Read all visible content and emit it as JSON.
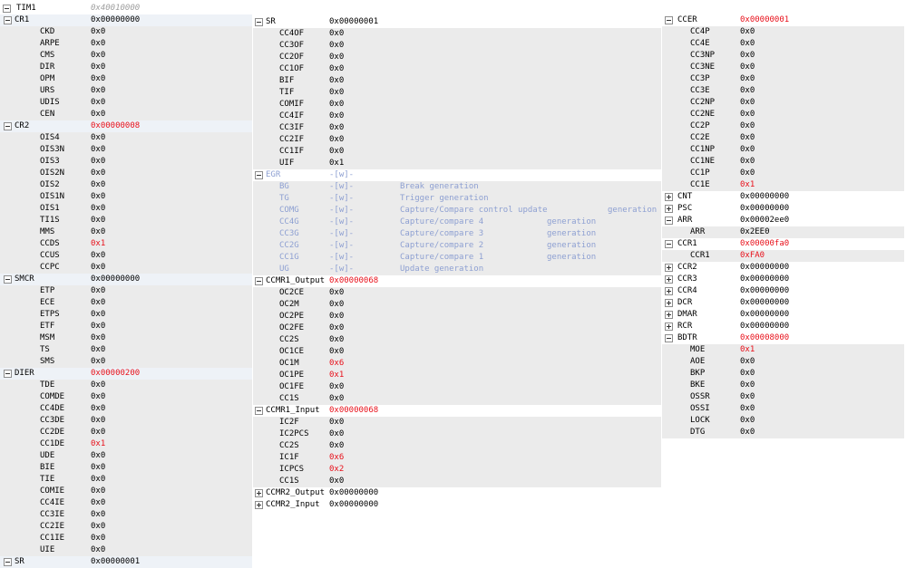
{
  "header": {
    "name": "TIM1",
    "address": "0x40010000"
  },
  "columns": [
    [
      {
        "name": "CR1",
        "value": "0x00000000",
        "expanded": true,
        "fields": [
          [
            "CKD",
            "0x0"
          ],
          [
            "ARPE",
            "0x0"
          ],
          [
            "CMS",
            "0x0"
          ],
          [
            "DIR",
            "0x0"
          ],
          [
            "OPM",
            "0x0"
          ],
          [
            "URS",
            "0x0"
          ],
          [
            "UDIS",
            "0x0"
          ],
          [
            "CEN",
            "0x0"
          ]
        ]
      },
      {
        "name": "CR2",
        "value": "0x00000008",
        "changed": true,
        "expanded": true,
        "fields": [
          [
            "OIS4",
            "0x0"
          ],
          [
            "OIS3N",
            "0x0"
          ],
          [
            "OIS3",
            "0x0"
          ],
          [
            "OIS2N",
            "0x0"
          ],
          [
            "OIS2",
            "0x0"
          ],
          [
            "OIS1N",
            "0x0"
          ],
          [
            "OIS1",
            "0x0"
          ],
          [
            "TI1S",
            "0x0"
          ],
          [
            "MMS",
            "0x0"
          ],
          [
            "CCDS",
            "0x1",
            true
          ],
          [
            "CCUS",
            "0x0"
          ],
          [
            "CCPC",
            "0x0"
          ]
        ]
      },
      {
        "name": "SMCR",
        "value": "0x00000000",
        "expanded": true,
        "fields": [
          [
            "ETP",
            "0x0"
          ],
          [
            "ECE",
            "0x0"
          ],
          [
            "ETPS",
            "0x0"
          ],
          [
            "ETF",
            "0x0"
          ],
          [
            "MSM",
            "0x0"
          ],
          [
            "TS",
            "0x0"
          ],
          [
            "SMS",
            "0x0"
          ]
        ]
      },
      {
        "name": "DIER",
        "value": "0x00000200",
        "changed": true,
        "expanded": true,
        "fields": [
          [
            "TDE",
            "0x0"
          ],
          [
            "COMDE",
            "0x0"
          ],
          [
            "CC4DE",
            "0x0"
          ],
          [
            "CC3DE",
            "0x0"
          ],
          [
            "CC2DE",
            "0x0"
          ],
          [
            "CC1DE",
            "0x1",
            true
          ],
          [
            "UDE",
            "0x0"
          ],
          [
            "BIE",
            "0x0"
          ],
          [
            "TIE",
            "0x0"
          ],
          [
            "COMIE",
            "0x0"
          ],
          [
            "CC4IE",
            "0x0"
          ],
          [
            "CC3IE",
            "0x0"
          ],
          [
            "CC2IE",
            "0x0"
          ],
          [
            "CC1IE",
            "0x0"
          ],
          [
            "UIE",
            "0x0"
          ]
        ]
      },
      {
        "name": "SR",
        "value": "0x00000001",
        "expanded": true,
        "fields": []
      }
    ],
    [
      {
        "name": "SR",
        "value": "0x00000001",
        "expanded": true,
        "fields": [
          [
            "CC4OF",
            "0x0"
          ],
          [
            "CC3OF",
            "0x0"
          ],
          [
            "CC2OF",
            "0x0"
          ],
          [
            "CC1OF",
            "0x0"
          ],
          [
            "BIF",
            "0x0"
          ],
          [
            "TIF",
            "0x0"
          ],
          [
            "COMIF",
            "0x0"
          ],
          [
            "CC4IF",
            "0x0"
          ],
          [
            "CC3IF",
            "0x0"
          ],
          [
            "CC2IF",
            "0x0"
          ],
          [
            "CC1IF",
            "0x0"
          ],
          [
            "UIF",
            "0x1"
          ]
        ]
      },
      {
        "name": "EGR",
        "value": "-[w]-",
        "writeonly": true,
        "expanded": true,
        "fields": [
          [
            "BG",
            "-[w]-",
            false,
            "Break generation",
            ""
          ],
          [
            "TG",
            "-[w]-",
            false,
            "Trigger generation",
            ""
          ],
          [
            "COMG",
            "-[w]-",
            false,
            "Capture/Compare control update",
            "generation"
          ],
          [
            "CC4G",
            "-[w]-",
            false,
            "Capture/compare 4",
            "generation"
          ],
          [
            "CC3G",
            "-[w]-",
            false,
            "Capture/compare 3",
            "generation"
          ],
          [
            "CC2G",
            "-[w]-",
            false,
            "Capture/compare 2",
            "generation"
          ],
          [
            "CC1G",
            "-[w]-",
            false,
            "Capture/compare 1",
            "generation"
          ],
          [
            "UG",
            "-[w]-",
            false,
            "Update generation",
            ""
          ]
        ]
      },
      {
        "name": "CCMR1_Output",
        "value": "0x00000068",
        "changed": true,
        "expanded": true,
        "fields": [
          [
            "OC2CE",
            "0x0"
          ],
          [
            "OC2M",
            "0x0"
          ],
          [
            "OC2PE",
            "0x0"
          ],
          [
            "OC2FE",
            "0x0"
          ],
          [
            "CC2S",
            "0x0"
          ],
          [
            "OC1CE",
            "0x0"
          ],
          [
            "OC1M",
            "0x6",
            true
          ],
          [
            "OC1PE",
            "0x1",
            true
          ],
          [
            "OC1FE",
            "0x0"
          ],
          [
            "CC1S",
            "0x0"
          ]
        ]
      },
      {
        "name": "CCMR1_Input",
        "value": "0x00000068",
        "changed": true,
        "expanded": true,
        "fields": [
          [
            "IC2F",
            "0x0"
          ],
          [
            "IC2PCS",
            "0x0"
          ],
          [
            "CC2S",
            "0x0"
          ],
          [
            "IC1F",
            "0x6",
            true
          ],
          [
            "ICPCS",
            "0x2",
            true
          ],
          [
            "CC1S",
            "0x0"
          ]
        ]
      },
      {
        "name": "CCMR2_Output",
        "value": "0x00000000",
        "expanded": false,
        "fields": []
      },
      {
        "name": "CCMR2_Input",
        "value": "0x00000000",
        "expanded": false,
        "fields": []
      }
    ],
    [
      {
        "name": "CCER",
        "value": "0x00000001",
        "changed": true,
        "expanded": true,
        "fields": [
          [
            "CC4P",
            "0x0"
          ],
          [
            "CC4E",
            "0x0"
          ],
          [
            "CC3NP",
            "0x0"
          ],
          [
            "CC3NE",
            "0x0"
          ],
          [
            "CC3P",
            "0x0"
          ],
          [
            "CC3E",
            "0x0"
          ],
          [
            "CC2NP",
            "0x0"
          ],
          [
            "CC2NE",
            "0x0"
          ],
          [
            "CC2P",
            "0x0"
          ],
          [
            "CC2E",
            "0x0"
          ],
          [
            "CC1NP",
            "0x0"
          ],
          [
            "CC1NE",
            "0x0"
          ],
          [
            "CC1P",
            "0x0"
          ],
          [
            "CC1E",
            "0x1",
            true
          ]
        ]
      },
      {
        "name": "CNT",
        "value": "0x00000000",
        "expanded": false,
        "fields": []
      },
      {
        "name": "PSC",
        "value": "0x00000000",
        "expanded": false,
        "fields": []
      },
      {
        "name": "ARR",
        "value": "0x00002ee0",
        "expanded": true,
        "fields": [
          [
            "ARR",
            "0x2EE0"
          ]
        ]
      },
      {
        "name": "CCR1",
        "value": "0x00000fa0",
        "changed": true,
        "expanded": true,
        "fields": [
          [
            "CCR1",
            "0xFA0",
            true
          ]
        ]
      },
      {
        "name": "CCR2",
        "value": "0x00000000",
        "expanded": false,
        "fields": []
      },
      {
        "name": "CCR3",
        "value": "0x00000000",
        "expanded": false,
        "fields": []
      },
      {
        "name": "CCR4",
        "value": "0x00000000",
        "expanded": false,
        "fields": []
      },
      {
        "name": "DCR",
        "value": "0x00000000",
        "expanded": false,
        "fields": []
      },
      {
        "name": "DMAR",
        "value": "0x00000000",
        "expanded": false,
        "fields": []
      },
      {
        "name": "RCR",
        "value": "0x00000000",
        "expanded": false,
        "fields": []
      },
      {
        "name": "BDTR",
        "value": "0x00008000",
        "changed": true,
        "expanded": true,
        "fields": [
          [
            "MOE",
            "0x1",
            true
          ],
          [
            "AOE",
            "0x0"
          ],
          [
            "BKP",
            "0x0"
          ],
          [
            "BKE",
            "0x0"
          ],
          [
            "OSSR",
            "0x0"
          ],
          [
            "OSSI",
            "0x0"
          ],
          [
            "LOCK",
            "0x0"
          ],
          [
            "DTG",
            "0x0"
          ]
        ]
      }
    ]
  ]
}
